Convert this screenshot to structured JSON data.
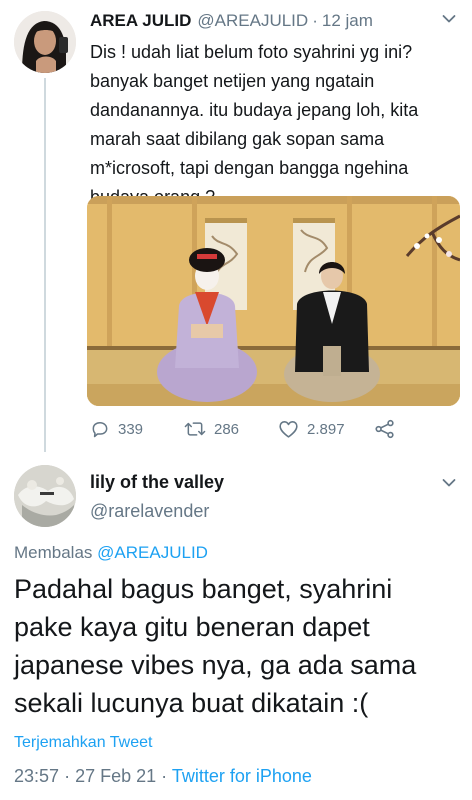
{
  "parent_tweet": {
    "display_name": "AREA JULID",
    "handle": "@AREAJULID",
    "separator": "·",
    "time": "12 jam",
    "text": "Dis ! udah liat belum foto syahrini yg ini?\nbanyak banget netijen yang ngatain\ndandanannya. itu budaya jepang loh, kita\nmarah saat dibilang gak sopan sama\nm*icrosoft, tapi dengan bangga ngehina\nbudaya orang ?",
    "actions": {
      "replies": "339",
      "retweets": "286",
      "likes": "2.897"
    },
    "icons": [
      "reply-icon",
      "retweet-icon",
      "like-icon",
      "share-icon",
      "chevron-down-icon"
    ]
  },
  "reply_tweet": {
    "display_name": "lily of the valley",
    "handle": "@rarelavender",
    "replying_prefix": "Membalas",
    "replying_to": "@AREAJULID",
    "text": "Padahal bagus banget, syahrini\npake kaya gitu beneran dapet\njapanese vibes nya, ga ada sama\nsekali lucunya buat dikatain :(",
    "translate_label": "Terjemahkan Tweet",
    "meta_time": "23:57",
    "meta_sep1": "·",
    "meta_date": "27 Feb 21",
    "meta_sep2": "·",
    "meta_source": "Twitter for iPhone"
  },
  "colors": {
    "accent": "#1da1f2",
    "secondary_text": "#657786",
    "primary_text": "#14171a"
  }
}
